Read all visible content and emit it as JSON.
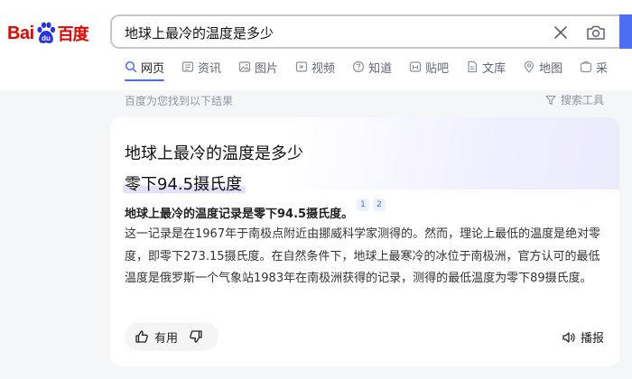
{
  "brand": {
    "logo_text_latin_1": "Bai",
    "logo_text_latin_2": "du",
    "logo_text_zh": "百度",
    "accent_color": "#e10601",
    "link_color": "#4e6ef2"
  },
  "search": {
    "query": "地球上最冷的温度是多少",
    "clear_icon": "close-icon",
    "camera_icon": "camera-icon"
  },
  "tabs": [
    {
      "label": "网页",
      "icon": "search-icon",
      "active": true
    },
    {
      "label": "资讯",
      "icon": "news-icon",
      "active": false
    },
    {
      "label": "图片",
      "icon": "image-icon",
      "active": false
    },
    {
      "label": "视频",
      "icon": "video-icon",
      "active": false
    },
    {
      "label": "知道",
      "icon": "question-icon",
      "active": false
    },
    {
      "label": "贴吧",
      "icon": "tieba-icon",
      "active": false
    },
    {
      "label": "文库",
      "icon": "document-icon",
      "active": false
    },
    {
      "label": "地图",
      "icon": "map-pin-icon",
      "active": false
    },
    {
      "label": "采",
      "icon": "shopping-icon",
      "active": false
    }
  ],
  "results": {
    "info": "百度为您找到以下结果",
    "tools_label": "搜索工具"
  },
  "answer_card": {
    "question": "地球上最冷的温度是多少",
    "answer": "零下94.5摄氏度",
    "summary": "地球上最冷的温度记录是零下94.5摄氏度。",
    "citations": [
      "1",
      "2"
    ],
    "body": "这一记录是在1967年于南极点附近由挪威科学家测得的。然而，理论上最低的温度是绝对零度，即零下273.15摄氏度。在自然条件下，地球上最寒冷的冰位于南极洲，官方认可的最低温度是俄罗斯一个气象站1983年在南极洲获得的记录，测得的最低温度为零下89摄氏度。",
    "useful_label": "有用",
    "play_label": "播报"
  }
}
